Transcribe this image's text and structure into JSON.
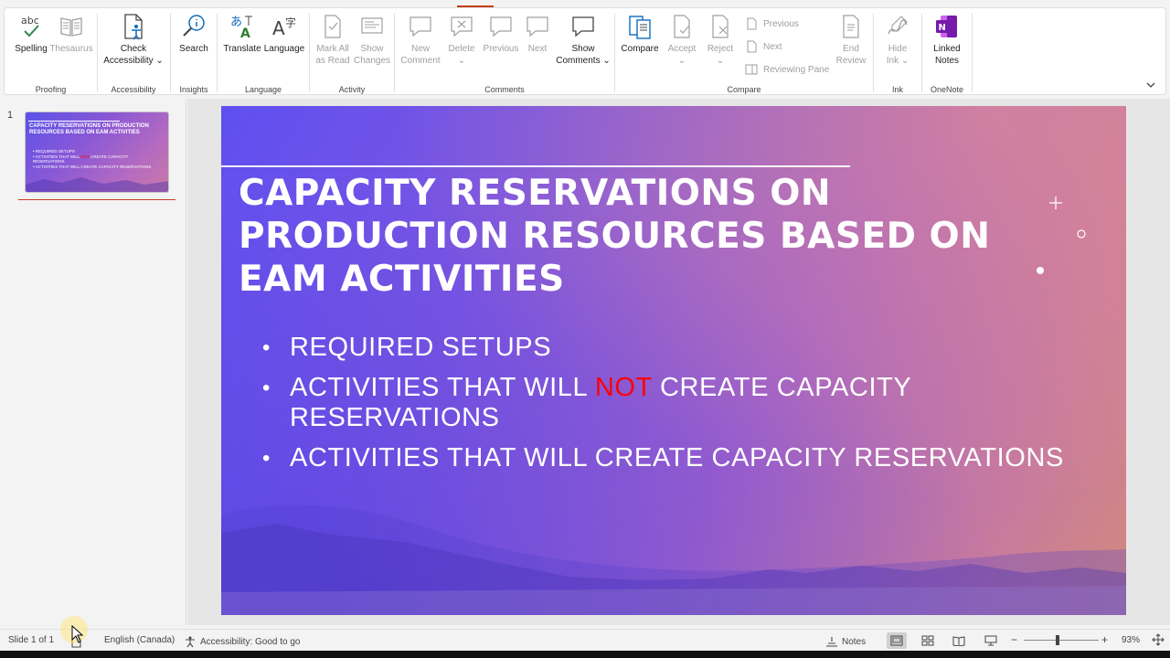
{
  "ribbon": {
    "proofing": {
      "group_label": "Proofing",
      "spelling_label": "Spelling",
      "thesaurus_label": "Thesaurus"
    },
    "accessibility": {
      "group_label": "Accessibility",
      "check_label_1": "Check",
      "check_label_2": "Accessibility ⌄"
    },
    "insights": {
      "group_label": "Insights",
      "search_label": "Search"
    },
    "language": {
      "group_label": "Language",
      "translate_label": "Translate",
      "language_label": "Language"
    },
    "activity": {
      "group_label": "Activity",
      "mark_all_1": "Mark All",
      "mark_all_2": "as Read",
      "show_changes_1": "Show",
      "show_changes_2": "Changes"
    },
    "comments": {
      "group_label": "Comments",
      "new_1": "New",
      "new_2": "Comment",
      "delete_label": "Delete",
      "delete_caret": "⌄",
      "previous_label": "Previous",
      "next_label": "Next",
      "show_comments_1": "Show",
      "show_comments_2": "Comments ⌄"
    },
    "compare": {
      "group_label": "Compare",
      "compare_label": "Compare",
      "accept_label": "Accept",
      "accept_caret": "⌄",
      "reject_label": "Reject",
      "reject_caret": "⌄",
      "previous_label": "Previous",
      "next_label": "Next",
      "reviewing_pane_label": "Reviewing Pane",
      "end_review_1": "End",
      "end_review_2": "Review"
    },
    "ink": {
      "group_label": "Ink",
      "hide_ink_1": "Hide",
      "hide_ink_2": "Ink ⌄"
    },
    "onenote": {
      "group_label": "OneNote",
      "linked_notes_1": "Linked",
      "linked_notes_2": "Notes"
    }
  },
  "thumbnails": {
    "slide_number": "1",
    "title": "CAPACITY RESERVATIONS ON PRODUCTION RESOURCES BASED ON EAM ACTIVITIES",
    "bullet_1": "• REQUIRED SETUPS",
    "bullet_2a": "• ACTIVITIES THAT WILL ",
    "bullet_2b": "NOT",
    "bullet_2c": " CREATE CAPACITY RESERVATIONS",
    "bullet_3": "• ACTIVITIES THAT WILL CREATE CAPACITY RESERVATIONS"
  },
  "slide": {
    "title": "CAPACITY RESERVATIONS ON PRODUCTION RESOURCES BASED ON EAM ACTIVITIES",
    "bullets": {
      "b1": "REQUIRED SETUPS",
      "b2_pre": "ACTIVITIES THAT WILL ",
      "b2_emph": "NOT",
      "b2_post": " CREATE CAPACITY RESERVATIONS",
      "b3": "ACTIVITIES THAT WILL CREATE CAPACITY RESERVATIONS"
    },
    "colors": {
      "emphasis": "#ff0000",
      "text": "#ffffff"
    }
  },
  "statusbar": {
    "slide_info": "Slide 1 of 1",
    "language": "English (Canada)",
    "accessibility": "Accessibility: Good to go",
    "notes_label": "Notes",
    "zoom_minus": "−",
    "zoom_plus": "+",
    "zoom_level": "93%"
  },
  "icons": {
    "spelling": "abc-check-icon",
    "thesaurus": "book-icon",
    "check_accessibility": "accessibility-check-icon",
    "search": "search-icon",
    "translate": "translate-icon",
    "language": "language-icon",
    "comment": "comment-icon",
    "compare": "compare-icon",
    "onenote": "onenote-icon"
  }
}
